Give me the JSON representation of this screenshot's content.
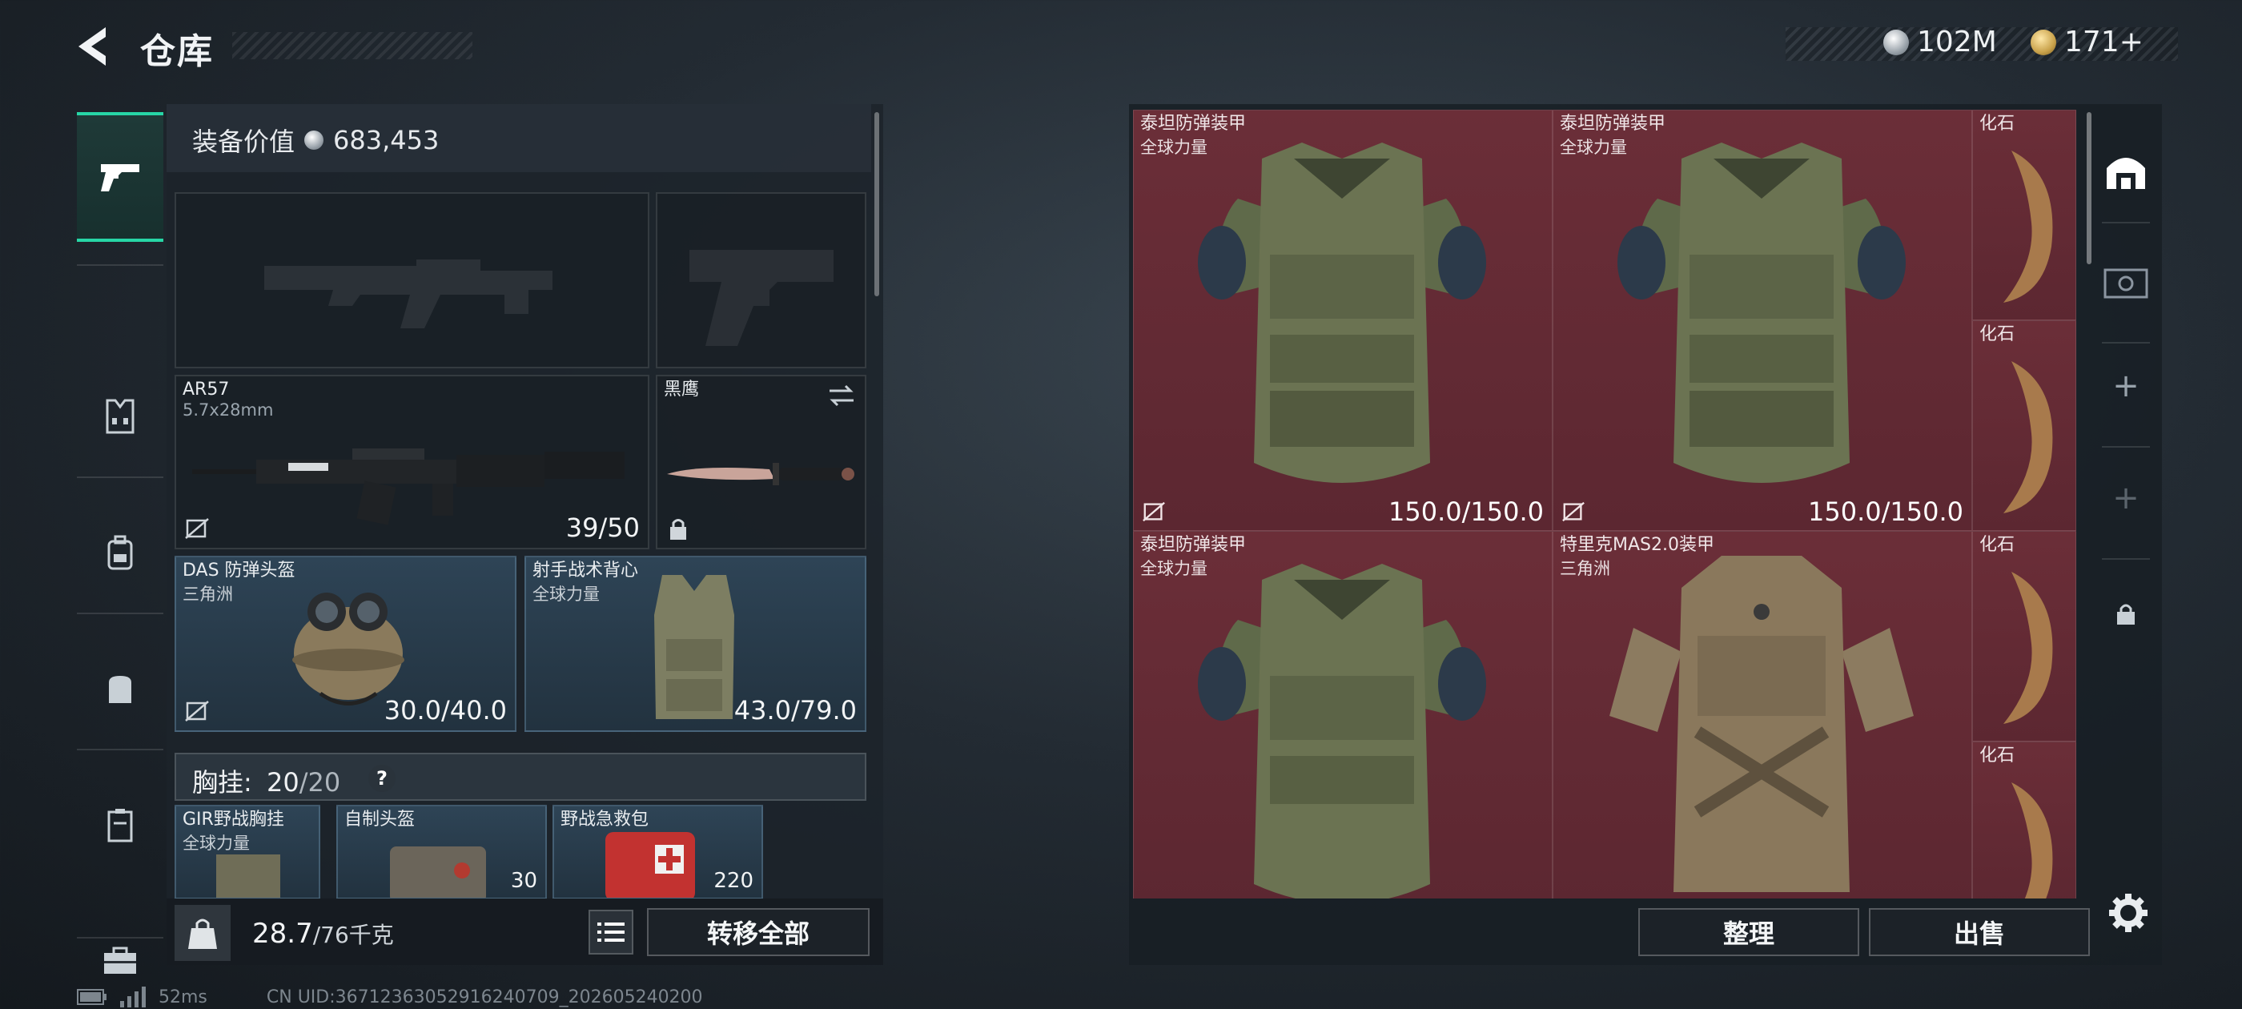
{
  "header": {
    "title": "仓库",
    "currency_silver": "102M",
    "currency_gold": "171+"
  },
  "equipment": {
    "value_label": "装备价值",
    "value": "683,453",
    "primary_weapon": {
      "name": "AR57",
      "caliber": "5.7x28mm",
      "ammo": "39/50"
    },
    "melee": {
      "name": "黑鹰"
    },
    "helmet": {
      "name": "DAS 防弹头盔",
      "source": "三角洲",
      "durability": "30.0/40.0"
    },
    "vest": {
      "name": "射手战术背心",
      "source": "全球力量",
      "durability": "43.0/79.0"
    },
    "rig": {
      "label": "胸挂:",
      "current": "20",
      "max": "20",
      "help": "?"
    },
    "rig_items": [
      {
        "name": "GIR野战胸挂",
        "source": "全球力量"
      },
      {
        "name": "自制头盔",
        "count": "30"
      },
      {
        "name": "野战急救包",
        "count": "220"
      }
    ]
  },
  "bottom_left": {
    "weight_current": "28.7",
    "weight_max": "/76千克",
    "transfer_all": "转移全部"
  },
  "stash": {
    "items": [
      {
        "name": "泰坦防弹装甲",
        "source": "全球力量",
        "durability": "150.0/150.0"
      },
      {
        "name": "泰坦防弹装甲",
        "source": "全球力量",
        "durability": "150.0/150.0"
      },
      {
        "name": "泰坦防弹装甲",
        "source": "全球力量"
      },
      {
        "name": "特里克MAS2.0装甲",
        "source": "三角洲"
      }
    ],
    "fossils": [
      "化石",
      "化石",
      "化石",
      "化石"
    ],
    "organize": "整理",
    "sell": "出售"
  },
  "status": {
    "ping": "52ms",
    "uid": "CN UID:36712363052916240709_202605240200"
  },
  "colors": {
    "accent": "#27d6a6",
    "stash_background": "#5c2731",
    "slot_blue": "#2e4456"
  },
  "icons": {
    "back": "chevron-left-icon",
    "weapons": "pistol-icon",
    "settings": "gear-icon",
    "lock": "lock-icon",
    "swap": "swap-icon"
  }
}
